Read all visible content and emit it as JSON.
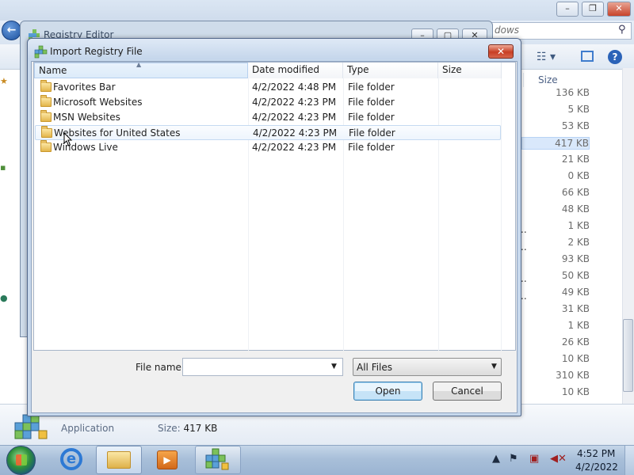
{
  "background_window": {
    "search_placeholder": "dows",
    "size_header": "Size",
    "sizes": [
      "136 KB",
      "5 KB",
      "53 KB",
      "417 KB",
      "21 KB",
      "0 KB",
      "66 KB",
      "48 KB",
      "1 KB",
      "2 KB",
      "93 KB",
      "50 KB",
      "49 KB",
      "31 KB",
      "1 KB",
      "26 KB",
      "10 KB",
      "310 KB",
      "10 KB"
    ],
    "selected_size_index": 3,
    "details": {
      "type": "Application",
      "size_label": "Size:",
      "size_value": "417 KB"
    }
  },
  "regedit": {
    "title": "Registry Editor"
  },
  "dialog": {
    "title": "Import Registry File",
    "columns": {
      "name": "Name",
      "date": "Date modified",
      "type": "Type",
      "size": "Size"
    },
    "files": [
      {
        "name": "Favorites Bar",
        "date": "4/2/2022 4:48 PM",
        "type": "File folder"
      },
      {
        "name": "Microsoft Websites",
        "date": "4/2/2022 4:23 PM",
        "type": "File folder"
      },
      {
        "name": "MSN Websites",
        "date": "4/2/2022 4:23 PM",
        "type": "File folder"
      },
      {
        "name": "Websites for United States",
        "date": "4/2/2022 4:23 PM",
        "type": "File folder"
      },
      {
        "name": "Windows Live",
        "date": "4/2/2022 4:23 PM",
        "type": "File folder"
      }
    ],
    "hovered_row_index": 3,
    "file_name_label": "File name:",
    "file_name_value": "",
    "file_type_selected": "All Files",
    "open_button": "Open",
    "cancel_button": "Cancel",
    "close_glyph": "✕"
  },
  "taskbar": {
    "clock_time": "4:52 PM",
    "clock_date": "4/2/2022",
    "pinned": [
      "internet-explorer-icon",
      "windows-explorer-icon",
      "media-player-icon",
      "registry-editor-icon"
    ]
  },
  "colors": {
    "title_close_red": "#c83e24",
    "selection_blue": "#d9e8fb",
    "taskbar_blue": "#a8bfd9"
  }
}
